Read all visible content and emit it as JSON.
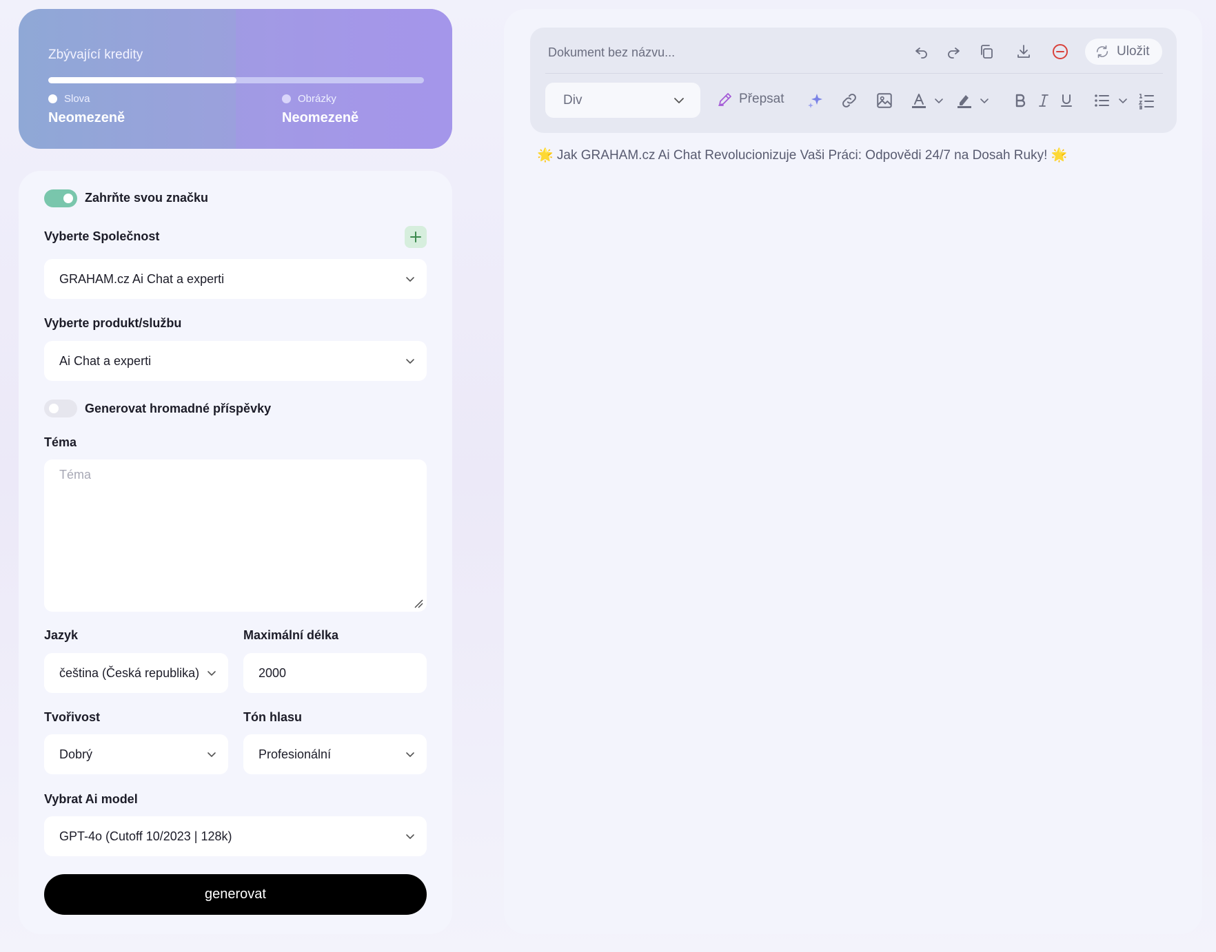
{
  "credits": {
    "title": "Zbývající kredity",
    "progress_fraction": 0.5,
    "words": {
      "label": "Slova",
      "value": "Neomezeně"
    },
    "images": {
      "label": "Obrázky",
      "value": "Neomezeně"
    }
  },
  "form": {
    "brand_toggle": {
      "label": "Zahrňte svou značku",
      "on": true
    },
    "company": {
      "label": "Vyberte Společnost",
      "value": "GRAHAM.cz Ai Chat a experti"
    },
    "product": {
      "label": "Vyberte produkt/službu",
      "value": "Ai Chat a experti"
    },
    "bulk_toggle": {
      "label": "Generovat hromadné příspěvky",
      "on": false
    },
    "topic": {
      "label": "Téma",
      "placeholder": "Téma"
    },
    "language": {
      "label": "Jazyk",
      "value": "čeština (Česká republika)"
    },
    "max_length": {
      "label": "Maximální délka",
      "value": "2000"
    },
    "creativity": {
      "label": "Tvořivost",
      "value": "Dobrý"
    },
    "tone": {
      "label": "Tón hlasu",
      "value": "Profesionální"
    },
    "model": {
      "label": "Vybrat Ai model",
      "value": "GPT-4o (Cutoff 10/2023 | 128k)"
    },
    "generate_label": "generovat"
  },
  "editor": {
    "doc_title_placeholder": "Dokument bez názvu...",
    "save_label": "Uložit",
    "block_type": "Div",
    "rewrite_label": "Přepsat",
    "content_headline": "🌟 Jak GRAHAM.cz Ai Chat Revolucionizuje Vaši Práci: Odpovědi 24/7 na Dosah Ruky! 🌟",
    "icons": [
      "undo-icon",
      "redo-icon",
      "copy-icon",
      "download-icon",
      "delete-icon",
      "refresh-icon",
      "pencil-icon",
      "sparkle-icon",
      "link-icon",
      "image-icon",
      "text-color-icon",
      "highlight-icon",
      "bold-icon",
      "italic-icon",
      "underline-icon",
      "bullet-list-icon",
      "numbered-list-icon"
    ]
  },
  "colors": {
    "accent_green": "#79c6ac",
    "delete_red": "#d9413b",
    "sparkle": "#7b83e6",
    "rewrite_purple": "#a45bd6"
  }
}
